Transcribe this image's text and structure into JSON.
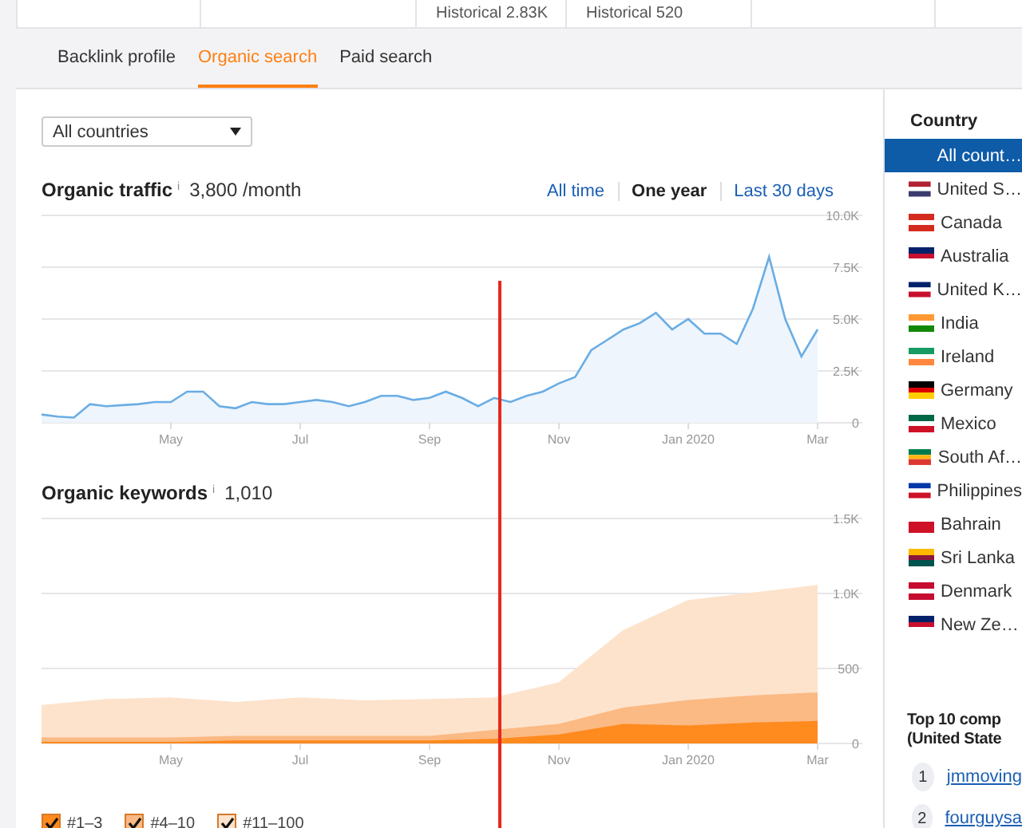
{
  "top_strip": {
    "cells": [
      "Historical 2.83K",
      "Historical 520"
    ]
  },
  "tabs": [
    {
      "label": "Backlink profile",
      "selected": false
    },
    {
      "label": "Organic search",
      "selected": true
    },
    {
      "label": "Paid search",
      "selected": false
    }
  ],
  "country_select": {
    "value": "All countries"
  },
  "traffic": {
    "info": "i",
    "value": "3,800 /month",
    "ranges": [
      {
        "label": "All time",
        "selected": false
      },
      {
        "label": "One year",
        "selected": true
      },
      {
        "label": "Last 30 days",
        "selected": false
      }
    ],
    "chart_data": {
      "type": "area",
      "categories": [
        null,
        null,
        null,
        null,
        null,
        null,
        null,
        null,
        "May",
        null,
        null,
        null,
        null,
        null,
        null,
        null,
        "Jul",
        null,
        null,
        null,
        null,
        null,
        null,
        null,
        "Sep",
        null,
        null,
        null,
        null,
        null,
        null,
        null,
        "Nov",
        null,
        null,
        null,
        null,
        null,
        null,
        null,
        "Jan 2020",
        null,
        null,
        null,
        null,
        null,
        null,
        null,
        "Mar"
      ],
      "series": [
        {
          "name": "Organic traffic",
          "color": "#6aade4",
          "values": [
            400,
            300,
            250,
            900,
            800,
            850,
            900,
            1000,
            1000,
            1500,
            1500,
            800,
            700,
            1000,
            900,
            900,
            1000,
            1100,
            1000,
            800,
            1000,
            1300,
            1300,
            1100,
            1200,
            1500,
            1200,
            800,
            1200,
            1000,
            1300,
            1500,
            1900,
            2200,
            3500,
            4000,
            4500,
            4800,
            5300,
            4500,
            5000,
            4300,
            4300,
            3800,
            5500,
            8000,
            5000,
            3200,
            4500
          ]
        }
      ],
      "ylim": [
        0,
        10000
      ],
      "grid": true,
      "yticks": [
        {
          "value": 0,
          "label": "0"
        },
        {
          "value": 2500,
          "label": "2.5K"
        },
        {
          "value": 5000,
          "label": "5.0K"
        },
        {
          "value": 7500,
          "label": "7.5K"
        },
        {
          "value": 10000,
          "label": "10.0K"
        }
      ]
    }
  },
  "keywords": {
    "title": "Organic keywords",
    "info": "i",
    "value": "1,010",
    "chart_data": {
      "type": "area",
      "stacked": true,
      "categories": [
        null,
        null,
        "May",
        null,
        "Jul",
        null,
        "Sep",
        null,
        "Nov",
        null,
        "Jan 2020",
        null,
        "Mar"
      ],
      "series": [
        {
          "name": "#1–3",
          "color": "#ff8a1e",
          "values": [
            10,
            10,
            10,
            20,
            20,
            20,
            20,
            30,
            60,
            130,
            120,
            140,
            150
          ]
        },
        {
          "name": "#4–10",
          "color": "#fbb983",
          "values": [
            30,
            30,
            30,
            30,
            30,
            30,
            30,
            60,
            70,
            110,
            170,
            180,
            190
          ]
        },
        {
          "name": "#11–100",
          "color": "#fde3cc",
          "values": [
            210,
            250,
            260,
            220,
            250,
            230,
            240,
            210,
            270,
            510,
            660,
            680,
            710
          ]
        }
      ],
      "ylim": [
        0,
        1500
      ],
      "grid": true,
      "yticks": [
        {
          "value": 0,
          "label": "0"
        },
        {
          "value": 500,
          "label": "500"
        },
        {
          "value": 1000,
          "label": "1.0K"
        },
        {
          "value": 1500,
          "label": "1.5K"
        }
      ]
    },
    "legend": [
      {
        "checked": true
      },
      {
        "checked": true
      },
      {
        "checked": true
      }
    ]
  },
  "country_panel": {
    "title": "Country",
    "items": [
      {
        "label": "All count…",
        "selected": true
      },
      {
        "label": "United S…",
        "selected": false
      },
      {
        "label": "Canada",
        "selected": false
      },
      {
        "label": "Australia",
        "selected": false
      },
      {
        "label": "United K…",
        "selected": false
      },
      {
        "label": "India",
        "selected": false
      },
      {
        "label": "Ireland",
        "selected": false
      },
      {
        "label": "Germany",
        "selected": false
      },
      {
        "label": "Mexico",
        "selected": false
      },
      {
        "label": "South Af…",
        "selected": false
      },
      {
        "label": "Philippines",
        "selected": false
      },
      {
        "label": "Bahrain",
        "selected": false
      },
      {
        "label": "Sri Lanka",
        "selected": false
      },
      {
        "label": "Denmark",
        "selected": false
      },
      {
        "label": "New Ze…",
        "selected": false
      }
    ]
  },
  "competitors": {
    "title_lines": [
      "Top 10 comp",
      "(United State"
    ],
    "items": [
      {
        "rank": "1",
        "domain": "jmmoving"
      },
      {
        "rank": "2",
        "domain": "fourguysa"
      }
    ]
  }
}
